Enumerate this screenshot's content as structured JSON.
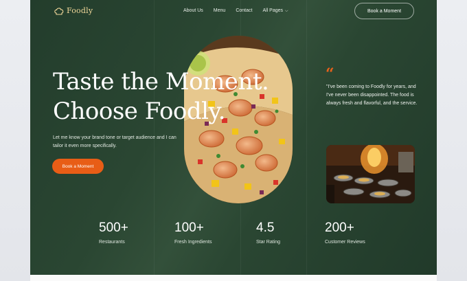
{
  "brand": {
    "name": "Foodly",
    "logo_icon": "chef-hat-icon",
    "accent": "#e85d16",
    "logo_color": "#f2d89a",
    "background": "#2a4632"
  },
  "nav": {
    "items": [
      "About Us",
      "Menu",
      "Contact",
      "All Pages"
    ],
    "dropdown_icon": "chevron-down-icon",
    "cta_label": "Book a Moment"
  },
  "hero": {
    "headline_line1": "Taste the Moment.",
    "headline_line2": "Choose Foodly.",
    "subtext": "Let me know your brand tone or target audience and I can tailor it even more specifically.",
    "cta_label": "Book a Moment",
    "image": "shrimp-tacos-photo"
  },
  "testimonial": {
    "quote_icon": "quote-icon",
    "text": "\"I've been coming to Foodly for years, and I've never been disappointed. The food is always fresh and flavorful, and the service.",
    "image": "kitchen-chef-photo"
  },
  "stats": [
    {
      "value": "500+",
      "label": "Restaurants"
    },
    {
      "value": "100+",
      "label": "Fresh Ingredients"
    },
    {
      "value": "4.5",
      "label": "Star Rating"
    },
    {
      "value": "200+",
      "label": "Customer Reviews"
    }
  ]
}
